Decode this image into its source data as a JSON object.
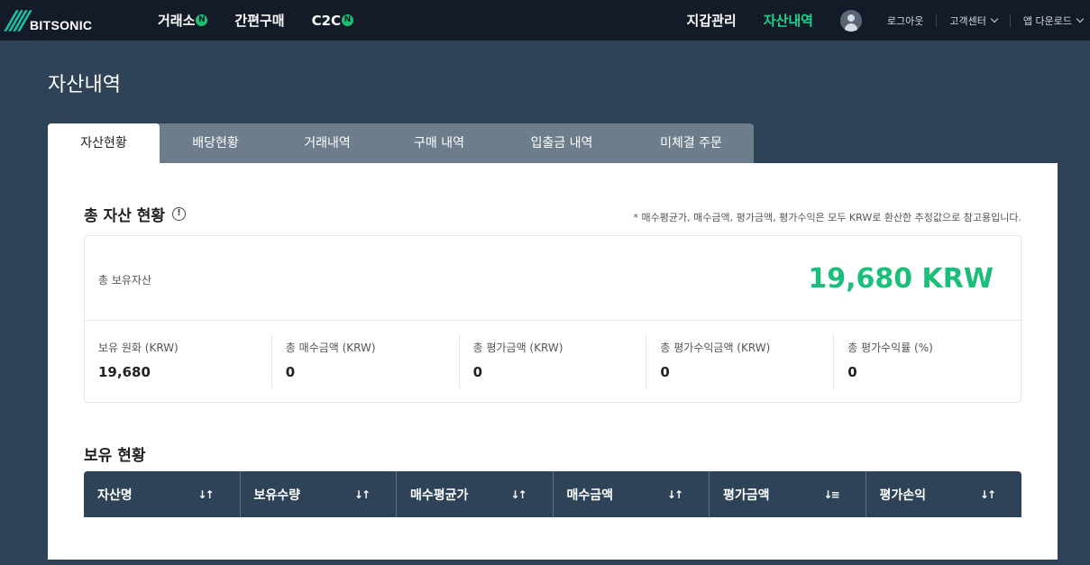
{
  "brand": {
    "name": "BITSONIC"
  },
  "nav": {
    "main": [
      {
        "label": "거래소",
        "badge": "N"
      },
      {
        "label": "간편구매"
      },
      {
        "label": "C2C",
        "badge": "N"
      }
    ],
    "wallet": "지갑관리",
    "assets": "자산내역",
    "logout": "로그아웃",
    "support": "고객센터",
    "app_download": "앱 다운로드"
  },
  "page": {
    "title": "자산내역"
  },
  "tabs": [
    "자산현황",
    "배당현황",
    "거래내역",
    "구매 내역",
    "입출금 내역",
    "미체결 주문"
  ],
  "summary": {
    "title": "총 자산 현황",
    "note": "* 매수평균가, 매수금액, 평가금액, 평가수익은 모두 KRW로 환산한 추정값으로 참고용입니다.",
    "total_label": "총 보유자산",
    "total_value": "19,680 KRW",
    "stats": [
      {
        "label": "보유 원화 (KRW)",
        "value": "19,680"
      },
      {
        "label": "총 매수금액 (KRW)",
        "value": "0"
      },
      {
        "label": "총 평가금액 (KRW)",
        "value": "0"
      },
      {
        "label": "총 평가수익금액 (KRW)",
        "value": "0"
      },
      {
        "label": "총 평가수익률 (%)",
        "value": "0"
      }
    ]
  },
  "holdings": {
    "title": "보유 현황",
    "columns": [
      "자산명",
      "보유수량",
      "매수평균가",
      "매수금액",
      "평가금액",
      "평가손익"
    ]
  },
  "colors": {
    "accent": "#1bbf7a",
    "nav_bg": "#121b27",
    "page_bg": "#2e4358"
  }
}
